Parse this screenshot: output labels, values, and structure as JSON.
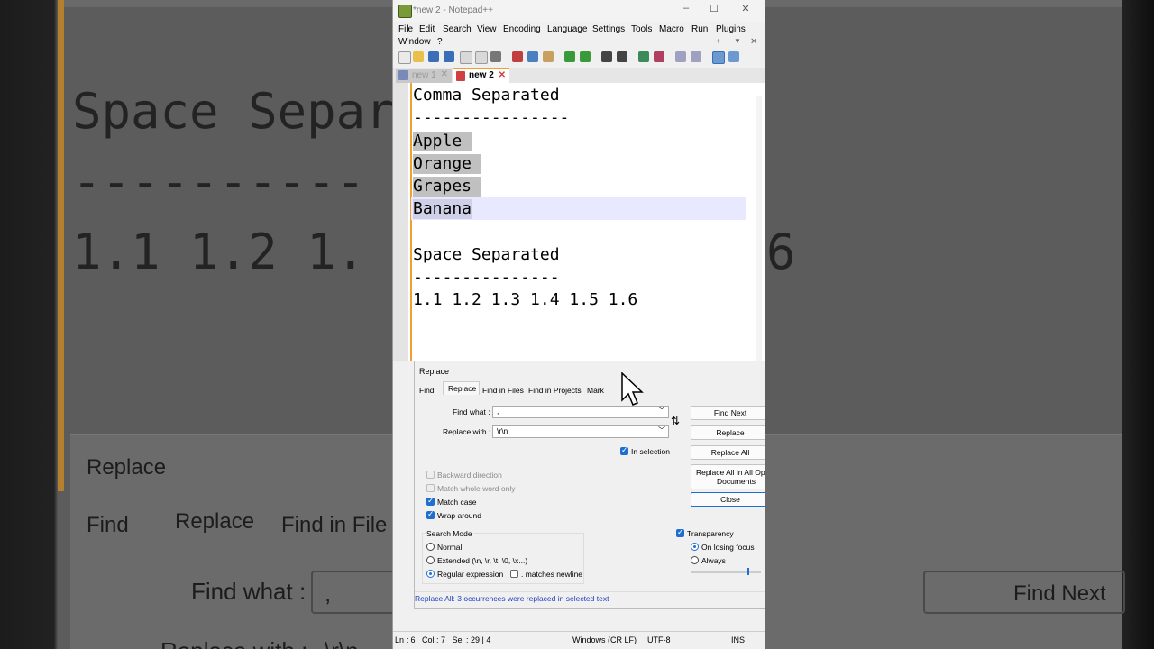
{
  "background": {
    "line1": "Space Separa",
    "line2": "----------",
    "line3": "1.1 1.2 1.",
    "line3_right": "6",
    "dialog_title": "Replace",
    "tab_find": "Find",
    "tab_replace": "Replace",
    "tab_find_in_files": "Find in File",
    "find_what_label": "Find what :",
    "find_what_value": ",",
    "replace_with_label": "Replace with :",
    "replace_with_value": "\\r\\n",
    "find_next": "Find Next"
  },
  "window": {
    "title": "*new 2 - Notepad++",
    "minimize": "–",
    "maximize": "☐",
    "close": "✕"
  },
  "menu": {
    "file": "File",
    "edit": "Edit",
    "search": "Search",
    "view": "View",
    "encoding": "Encoding",
    "language": "Language",
    "settings": "Settings",
    "tools": "Tools",
    "macro": "Macro",
    "run": "Run",
    "plugins": "Plugins",
    "window": "Window",
    "help": "?",
    "plus": "+",
    "dropdown": "▼",
    "close": "✕"
  },
  "tabs": [
    {
      "label": "new 1",
      "close": "✕"
    },
    {
      "label": "new 2",
      "close": "✕"
    }
  ],
  "editor": {
    "lines": [
      "Comma Separated",
      "----------------",
      "Apple",
      "Orange",
      "Grapes",
      "Banana",
      "",
      "Space Separated",
      "---------------",
      "1.1 1.2 1.3 1.4 1.5 1.6"
    ]
  },
  "dialog": {
    "title": "Replace",
    "tabs": [
      "Find",
      "Replace",
      "Find in Files",
      "Find in Projects",
      "Mark"
    ],
    "find_what_label": "Find what :",
    "find_what_value": ",",
    "replace_with_label": "Replace with :",
    "replace_with_value": "\\r\\n",
    "swap": "⇅",
    "in_selection": "In selection",
    "buttons": {
      "find_next": "Find Next",
      "replace": "Replace",
      "replace_all": "Replace All",
      "replace_all_open_1": "Replace All in All Open",
      "replace_all_open_2": "Documents",
      "close": "Close"
    },
    "options": {
      "backward": "Backward direction",
      "whole_word": "Match whole word only",
      "match_case": "Match case",
      "wrap_around": "Wrap around"
    },
    "search_mode": {
      "title": "Search Mode",
      "normal": "Normal",
      "extended": "Extended (\\n, \\r, \\t, \\0, \\x...)",
      "regex": "Regular expression",
      "matches_newline": ". matches newline"
    },
    "transparency": {
      "title": "Transparency",
      "on_losing_focus": "On losing focus",
      "always": "Always"
    },
    "status": "Replace All: 3 occurrences were replaced in selected text"
  },
  "statusbar": {
    "position": "Ln : 6   Col : 7   Sel : 29 | 4",
    "eol": "Windows (CR LF)",
    "encoding": "UTF-8",
    "mode": "INS"
  },
  "colors": {
    "accent_blue": "#1f6fd0",
    "tab_orange": "#f0a030",
    "status_blue": "#1f3fbf"
  }
}
